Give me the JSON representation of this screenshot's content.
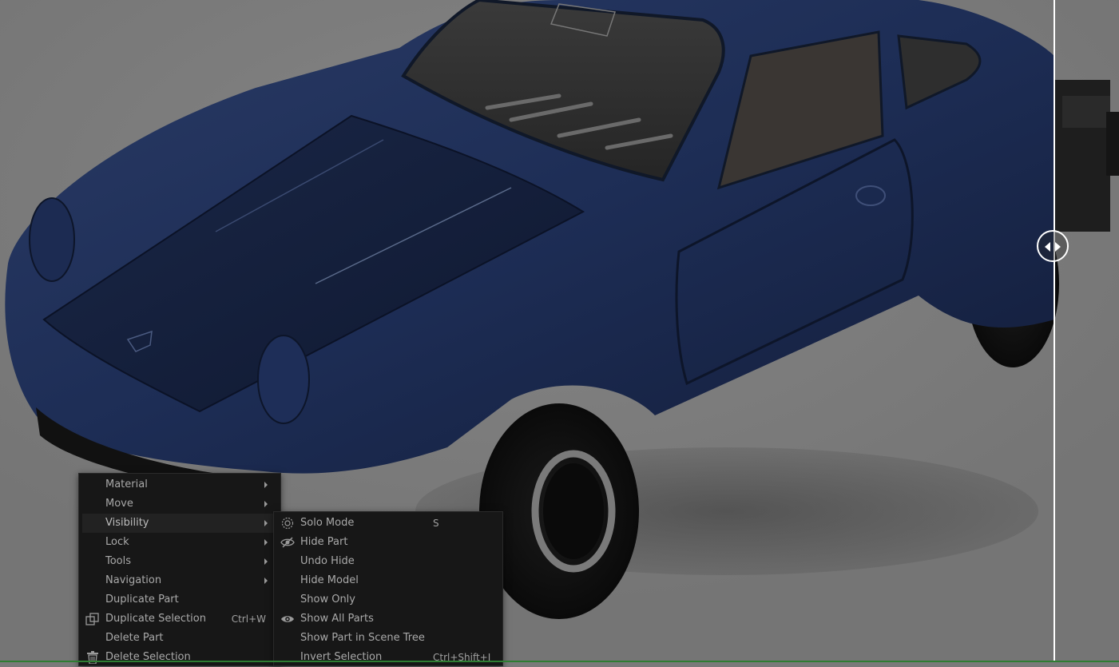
{
  "context_menu": {
    "items": [
      {
        "label": "Material",
        "shortcut": "",
        "icon": "",
        "submenu": true
      },
      {
        "label": "Move",
        "shortcut": "",
        "icon": "",
        "submenu": true
      },
      {
        "label": "Visibility",
        "shortcut": "",
        "icon": "",
        "submenu": true,
        "active": true
      },
      {
        "label": "Lock",
        "shortcut": "",
        "icon": "",
        "submenu": true
      },
      {
        "label": "Tools",
        "shortcut": "",
        "icon": "",
        "submenu": true
      },
      {
        "label": "Navigation",
        "shortcut": "",
        "icon": "",
        "submenu": true
      },
      {
        "label": "Duplicate Part",
        "shortcut": "",
        "icon": "",
        "submenu": false
      },
      {
        "label": "Duplicate Selection",
        "shortcut": "Ctrl+W",
        "icon": "duplicate-icon",
        "submenu": false
      },
      {
        "label": "Delete Part",
        "shortcut": "",
        "icon": "",
        "submenu": false
      },
      {
        "label": "Delete Selection",
        "shortcut": "",
        "icon": "trash-icon",
        "submenu": false
      }
    ]
  },
  "visibility_submenu": {
    "items": [
      {
        "label": "Solo Mode",
        "shortcut": "S",
        "icon": "solo-mode-icon"
      },
      {
        "label": "Hide Part",
        "shortcut": "",
        "icon": "eye-slash-icon"
      },
      {
        "label": "Undo Hide",
        "shortcut": "",
        "icon": ""
      },
      {
        "label": "Hide Model",
        "shortcut": "",
        "icon": ""
      },
      {
        "label": "Show Only",
        "shortcut": "",
        "icon": ""
      },
      {
        "label": "Show All Parts",
        "shortcut": "",
        "icon": "eye-icon"
      },
      {
        "label": "Show Part in Scene Tree",
        "shortcut": "",
        "icon": ""
      },
      {
        "label": "Invert Selection",
        "shortcut": "Ctrl+Shift+I",
        "icon": ""
      }
    ]
  },
  "viewport": {
    "model": "car",
    "comparison_slider_icon": "split-view-handle-icon",
    "colors": {
      "background": "#7a7a7a",
      "car_body": "#1c2d55",
      "menu_bg": "#171717",
      "menu_text": "#a9a9a9",
      "divider": "#ffffff"
    }
  }
}
